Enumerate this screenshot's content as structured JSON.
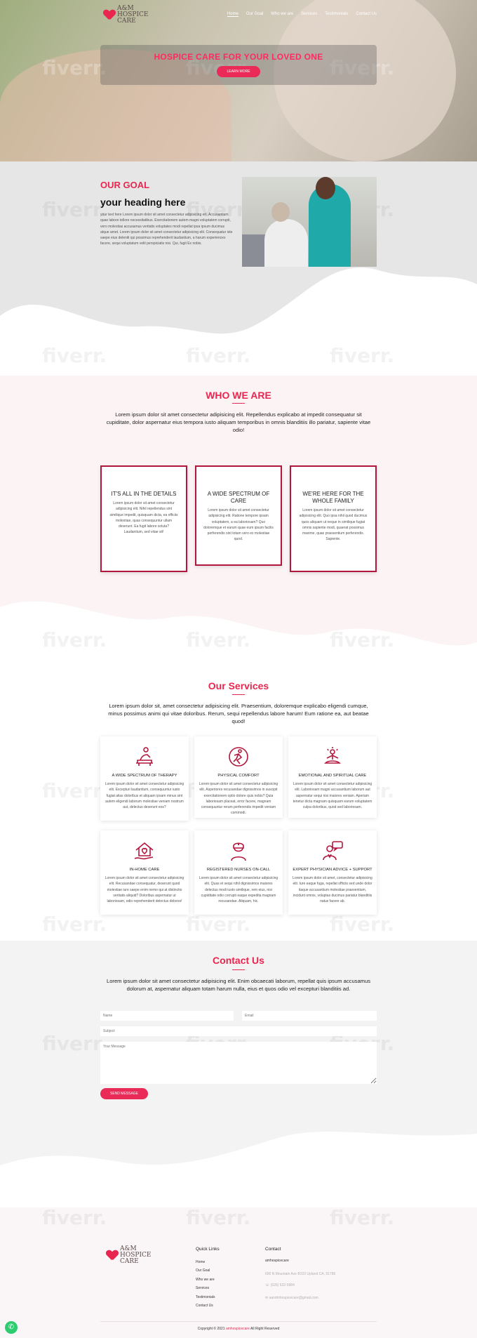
{
  "brand": {
    "logo_line1": "A&M",
    "logo_line2": "HOSPICE",
    "logo_line3": "CARE"
  },
  "nav": [
    "Home",
    "Our Goal",
    "Who we are",
    "Services",
    "Testimonials",
    "Contact Us"
  ],
  "watermark": "fiverr.",
  "hero": {
    "title": "HOSPICE CARE FOR YOUR LOVED ONE",
    "button": "LEARN MORE"
  },
  "goal": {
    "kicker": "OUR GOAL",
    "title": "your heading here",
    "text": "your text here Lorem ipsum dolor sit amet consectetur adipisicing ert. Accusantium quae labore tellore necessitatibus. Exercitationem autem magni voluptatem corrupti, vero molestias accusamus veritatis voluptates modi repellat ipsa ipsum ducimus atque amet. Lorem ipsum dolor sit amet consectetur adipisicing elit. Consequatur iste saepe eius deleniti qui possimus reprehenderit laudantium, a harum experiences facere, sequi voluptatum velit perspiciatis nisi. Qui, fugit Ex nobis."
  },
  "who": {
    "title": "WHO WE ARE",
    "text": "Lorem ipsum dolor sit amet consectetur adipisicing elit. Repellendus explicabo at impedit consequatur sit cupiditate, dolor aspernatur eius tempora iusto aliquam temporibus in omnis blanditiis illo pariatur, sapiente vitae odio!",
    "cards": [
      {
        "title": "IT'S ALL IN THE DETAILS",
        "text": "Lorem ipsum dolor sit amet consectetur adipisicing elit. Nihil repellendus sint similique impedit, quisquam dicta, ea officiis molestiae, quas consequuntur ullam deserunt. Ea fugit labore soluta? Laudantium, sed vitae sit!"
      },
      {
        "title": "A WIDE SPECTRUM OF CARE",
        "text": "Lorem ipsum dolor sit amet consectetur adipisicing elit. Ratione tempore ipsam voluptatem, a ea laboriosam? Quo doloremque et earum quae eum ipsum facilis perferendis sint totam vero ex molestiae quod."
      },
      {
        "title": "WE'RE HERE FOR THE WHOLE FAMILY",
        "text": "Lorem ipsum dolor sit amet consectetur adipisicing elit. Quo ipsa nihil quod ducimus quos aliquam ut neque in similique fugiat omnis sapiente modi, quaerat possimus maxime, quae praesentium perferendis. Sapiente."
      }
    ]
  },
  "services": {
    "title": "Our Services",
    "text": "Lorem ipsum dolor sit, amet consectetur adipisicing elit. Praesentium, doloremque explicabo eligendi cumque, minus possimus animi qui vitae doloribus. Rerum, sequi repellendus labore harum! Eum ratione ea, aut beatae quod!",
    "items": [
      {
        "icon": "massage-therapy-icon",
        "title": "A WIDE SPECTRUM OF THERAPY",
        "text": "Lorem ipsum dolor sit amet consectetur adipisicing elit. Excepturi laudantium, consequuntur iusto fugiat alias doloribus et aliquam ipsam minus sint autem eligendi laborum molestiae veniam nostrum aut, delectus deserunt eos?"
      },
      {
        "icon": "physical-activity-icon",
        "title": "PHYSICAL COMFORT",
        "text": "Lorem ipsum dolor sit amet consectetur adipisicing elit. Asperiores recusandae dignissimos in suscipit exercitationem optio dolore quis nobis? Quia laboriosam placeat, error facere, magnam consequuntur rerum perferendis impedit veniam commodi."
      },
      {
        "icon": "meditation-icon",
        "title": "EMOTIONAL AND SPIRITUAL CARE",
        "text": "Lorem ipsum dolor sit amet consectetur adipisicing elit. Laboriosam magni accusantium laborum aut aspernatur sequi nisi maiores veniam. Aperiam tenetur dicta magnam quisquam earum voluptatem culpa doloribus, quod sed laboriosam."
      },
      {
        "icon": "home-care-icon",
        "title": "IN-HOME CARE",
        "text": "Lorem ipsum dolor sit amet consectetur adipisicing elit. Recusandae consequatur, deserunt quod molestiae iure saepe enim nemo qui at distinctio veritatis aliquid? Doloribus aspernatur ut laboriosam, odio reprehenderit delectus dolores!"
      },
      {
        "icon": "nurse-icon",
        "title": "REGISTERED NURSES ON-CALL",
        "text": "Lorem ipsum dolor sit amet consectetur adipisicing elit. Quas et sequi nihil dignissimos maiores delectus modi iusto similique, rem eius, nisi cupiditate odio corrupti eaque expedita magnam recusandae. Aliquam, hic."
      },
      {
        "icon": "physician-chat-icon",
        "title": "EXPERT PHYSICIAN ADVICE + SUPPORT",
        "text": "Lorem ipsum dolor sit amet, consectetur adipisicing elit. Iure eaque fuga, repellat officiis sed unde dolor itaque accusantium molestiae praesentium, incidunt omnis, voluptas ducimus pariatur blanditiis natus facere ab."
      }
    ]
  },
  "contact": {
    "title": "Contact Us",
    "text": "Lorem ipsum dolor sit amet consectetur adipisicing elit. Enim obcaecati laborum, repellat quis ipsum accusamus dolorum at, aspernatur aliquam totam harum nulla, eius et quos odio vel excepturi blanditiis ad.",
    "name_placeholder": "Name",
    "email_placeholder": "Email",
    "subject_placeholder": "Subject",
    "message_placeholder": "Your Message",
    "button": "SEND MESSAGE"
  },
  "footer": {
    "quick_links_title": "Quick Links",
    "links": [
      "Home",
      "Our Goal",
      "Who we are",
      "Services",
      "Testimonials",
      "Contact Us"
    ],
    "contact_title": "Contact",
    "contact_name": "amhospicecare",
    "address": "600 N Mountain Ave B103 Upland CA, 91786",
    "phone": "(626) 532-5984",
    "email": "aandmhospicecare@gmail.com",
    "copyright_prefix": "Copyright © 2021",
    "copyright_brand": "amhospicecare",
    "copyright_suffix": "All Right Reserved"
  },
  "colors": {
    "accent": "#e8264f",
    "card_border": "#b3163c",
    "whatsapp": "#2ecc71"
  }
}
